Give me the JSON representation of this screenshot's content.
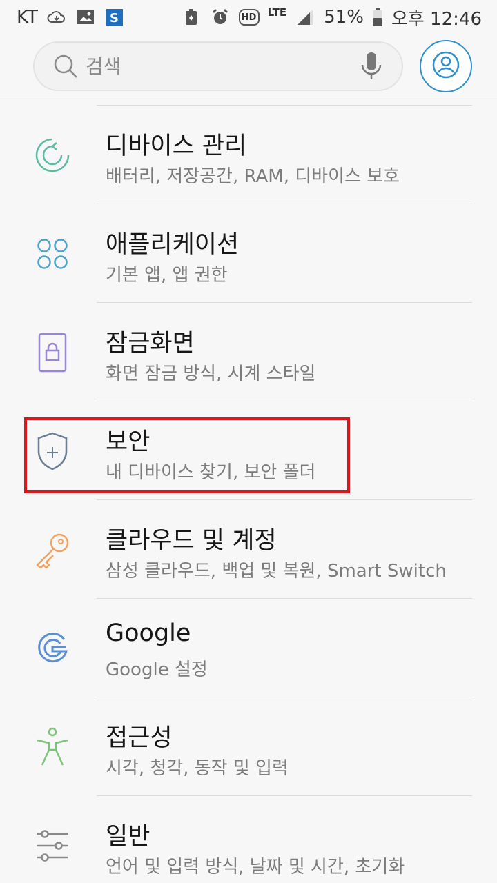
{
  "status_bar": {
    "carrier": "KT",
    "hd_label": "HD",
    "lte_label": "LTE",
    "battery": "51%",
    "time": "오후 12:46"
  },
  "search": {
    "placeholder": "검색"
  },
  "settings": [
    {
      "title": "디바이스 관리",
      "subtitle": "배터리, 저장공간, RAM, 디바이스 보호",
      "icon": "device-maintenance-icon",
      "color": "#5bbca0"
    },
    {
      "title": "애플리케이션",
      "subtitle": "기본 앱, 앱 권한",
      "icon": "apps-icon",
      "color": "#4fa3c9"
    },
    {
      "title": "잠금화면",
      "subtitle": "화면 잠금 방식, 시계 스타일",
      "icon": "lock-screen-icon",
      "color": "#9a86d6"
    },
    {
      "title": "보안",
      "subtitle": "내 디바이스 찾기, 보안 폴더",
      "icon": "shield-icon",
      "color": "#6b7e96"
    },
    {
      "title": "클라우드 및 계정",
      "subtitle": "삼성 클라우드, 백업 및 복원, Smart Switch",
      "icon": "key-icon",
      "color": "#f0a35e"
    },
    {
      "title": "Google",
      "subtitle": "Google 설정",
      "icon": "google-icon",
      "color": "#5a8fd6"
    },
    {
      "title": "접근성",
      "subtitle": "시각, 청각, 동작 및 입력",
      "icon": "accessibility-icon",
      "color": "#7cc47a"
    },
    {
      "title": "일반",
      "subtitle": "언어 및 입력 방식, 날짜 및 시간, 초기화",
      "icon": "general-management-icon",
      "color": "#8a8a8a"
    }
  ],
  "colors": {
    "highlight": "#e0161b",
    "accent": "#2e8fca"
  }
}
